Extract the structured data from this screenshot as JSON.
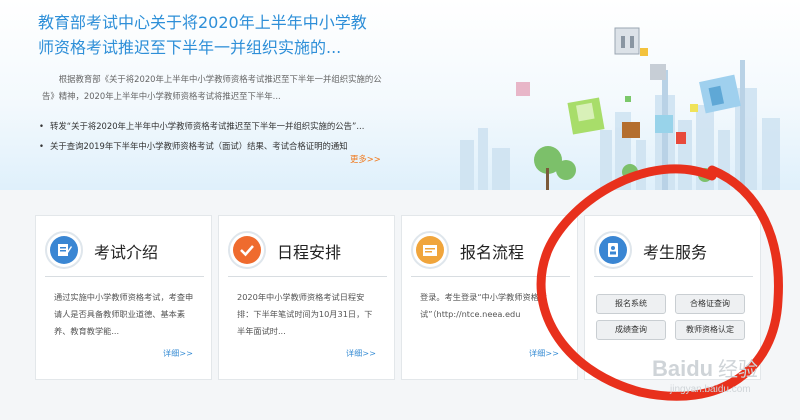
{
  "hero": {
    "title": "教育部考试中心关于将2020年上半年中小学教师资格考试推迟至下半年一并组织实施的...",
    "summary": "根据教育部《关于将2020年上半年中小学教师资格考试推迟至下半年一并组织实施的公告》精神，2020年上半年中小学教师资格考试将推迟至下半年...",
    "items": [
      {
        "bullet": "•",
        "text": "转发“关于将2020年上半年中小学教师资格考试推迟至下半年一并组织实施的公告”..."
      },
      {
        "bullet": "•",
        "text": "关于查询2019年下半年中小学教师资格考试（面试）结果、考试合格证明的通知"
      }
    ],
    "more": "更多>>"
  },
  "cards": [
    {
      "title": "考试介绍",
      "icon": "document-edit-icon",
      "text": "通过实施中小学教师资格考试，考查申请人是否具备教师职业道德、基本素养、教育教学能...",
      "more": "详细>>"
    },
    {
      "title": "日程安排",
      "icon": "checkmark-icon",
      "text": "2020年中小学教师资格考试日程安排：下半年笔试时间为10月31日，下半年面试时...",
      "more": "详细>>"
    },
    {
      "title": "报名流程",
      "icon": "form-list-icon",
      "text": "登录。考生登录“中小学教师资格考试”（http://ntce.neea.edu",
      "more": "详细>>"
    },
    {
      "title": "考生服务",
      "icon": "id-card-icon"
    }
  ],
  "services": [
    "报名系统",
    "合格证查询",
    "成绩查询",
    "教师资格认定"
  ],
  "watermark": {
    "line1": "Baidu",
    "line2": "经验",
    "url": "jingyan.baidu.com"
  },
  "colors": {
    "title_blue": "#2e8fd8",
    "more_orange": "#f07a1e",
    "link_blue": "#3c8fd5",
    "icon_blue": "#3a86d3",
    "icon_orange": "#ef6b2e",
    "icon_amber": "#f0a53c",
    "annotation_red": "#e8301c"
  }
}
